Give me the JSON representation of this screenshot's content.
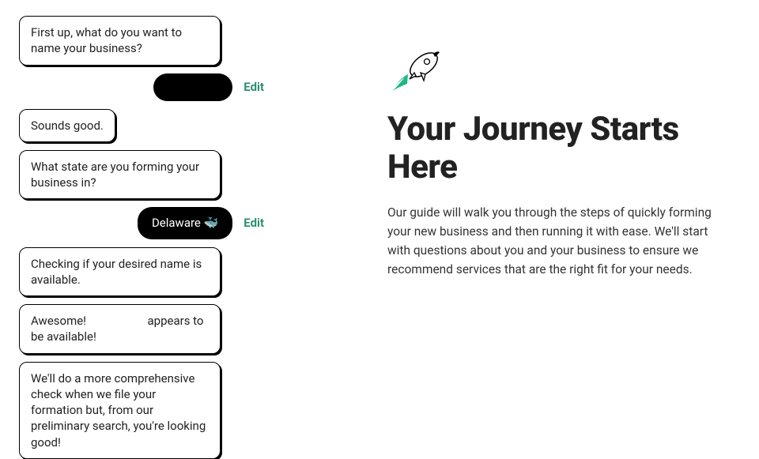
{
  "chat": {
    "msg1": "First up, what do you want to name your business?",
    "user1": "",
    "edit1": "Edit",
    "msg2": "Sounds good.",
    "msg3": "What state are you forming your business in?",
    "user2": "Delaware 🐳",
    "edit2": "Edit",
    "msg4": "Checking if your desired name is available.",
    "msg5_a": "Awesome! ",
    "msg5_b": " appears to be available!",
    "msg6": "We'll do a more comprehensive check when we file your formation but, from our preliminary search, you're looking good!"
  },
  "hero": {
    "title": "Your Journey Starts Here",
    "body": "Our guide will walk you through the steps of quickly forming your new business and then running it with ease. We'll start with questions about you and your business to ensure we recommend services that are the right fit for your needs."
  }
}
